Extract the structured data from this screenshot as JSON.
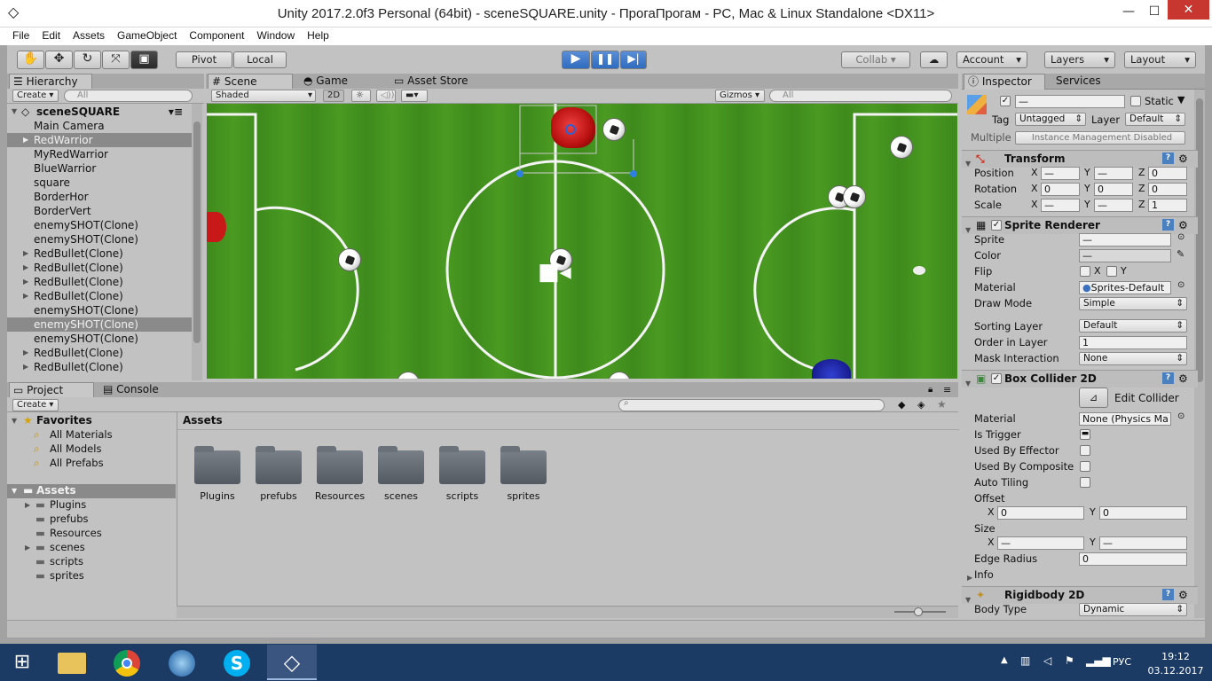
{
  "window": {
    "title": "Unity 2017.2.0f3 Personal (64bit) - sceneSQUARE.unity - ПрогаПрогам - PC, Mac & Linux Standalone <DX11>",
    "minimize": "—",
    "maximize": "☐",
    "close": "✕"
  },
  "menu": [
    "File",
    "Edit",
    "Assets",
    "GameObject",
    "Component",
    "Window",
    "Help"
  ],
  "toolbar": {
    "pivot": "Pivot",
    "local": "Local",
    "collab": "Collab ▾",
    "account": "Account",
    "layers": "Layers",
    "layout": "Layout"
  },
  "hierarchy": {
    "tab": "Hierarchy",
    "create": "Create ▾",
    "search_placeholder": "All",
    "scene": "sceneSQUARE",
    "items": [
      "Main Camera",
      "RedWarrior",
      "MyRedWarrior",
      "BlueWarrior",
      "square",
      "BorderHor",
      "BorderVert",
      "enemySHOT(Clone)",
      "enemySHOT(Clone)",
      "RedBullet(Clone)",
      "RedBullet(Clone)",
      "RedBullet(Clone)",
      "RedBullet(Clone)",
      "enemySHOT(Clone)",
      "enemySHOT(Clone)",
      "enemySHOT(Clone)",
      "RedBullet(Clone)",
      "RedBullet(Clone)"
    ]
  },
  "scene": {
    "tab_scene": "Scene",
    "tab_game": "Game",
    "tab_store": "Asset Store",
    "shaded": "Shaded",
    "mode2d": "2D",
    "gizmos": "Gizmos ▾",
    "search_placeholder": "All"
  },
  "project": {
    "tab_project": "Project",
    "tab_console": "Console",
    "create": "Create ▾",
    "favorites": "Favorites",
    "fav_items": [
      "All Materials",
      "All Models",
      "All Prefabs"
    ],
    "assets": "Assets",
    "asset_tree": [
      "Plugins",
      "prefubs",
      "Resources",
      "scenes",
      "scripts",
      "sprites"
    ],
    "assets_header": "Assets",
    "folders": [
      "Plugins",
      "prefubs",
      "Resources",
      "scenes",
      "scripts",
      "sprites"
    ]
  },
  "inspector": {
    "tab_inspector": "Inspector",
    "tab_services": "Services",
    "name": "—",
    "static": "Static",
    "tag_label": "Tag",
    "tag": "Untagged",
    "layer_label": "Layer",
    "layer": "Default",
    "multiple": "Multiple",
    "multiple_value": "Instance Management Disabled",
    "transform": {
      "title": "Transform",
      "position": "Position",
      "rotation": "Rotation",
      "scale": "Scale",
      "pos": [
        "—",
        "—",
        "0"
      ],
      "rot": [
        "0",
        "0",
        "0"
      ],
      "scl": [
        "—",
        "—",
        "1"
      ]
    },
    "sprite_renderer": {
      "title": "Sprite Renderer",
      "sprite": "Sprite",
      "sprite_val": "—",
      "color": "Color",
      "color_val": "—",
      "flip": "Flip",
      "material": "Material",
      "material_val": "Sprites-Default",
      "draw_mode": "Draw Mode",
      "draw_mode_val": "Simple",
      "sorting_layer": "Sorting Layer",
      "sorting_layer_val": "Default",
      "order": "Order in Layer",
      "order_val": "1",
      "mask": "Mask Interaction",
      "mask_val": "None"
    },
    "box_collider": {
      "title": "Box Collider 2D",
      "edit": "Edit Collider",
      "material": "Material",
      "material_val": "None (Physics Ma",
      "is_trigger": "Is Trigger",
      "used_effector": "Used By Effector",
      "used_composite": "Used By Composite",
      "auto_tiling": "Auto Tiling",
      "offset": "Offset",
      "offset_x": "0",
      "offset_y": "0",
      "size": "Size",
      "size_x": "—",
      "size_y": "—",
      "edge_radius": "Edge Radius",
      "edge_radius_val": "0",
      "info": "Info"
    },
    "rigidbody": {
      "title": "Rigidbody 2D",
      "body_type": "Body Type",
      "body_type_val": "Dynamic"
    }
  },
  "taskbar": {
    "lang": "РУС",
    "time": "19:12",
    "date": "03.12.2017"
  }
}
